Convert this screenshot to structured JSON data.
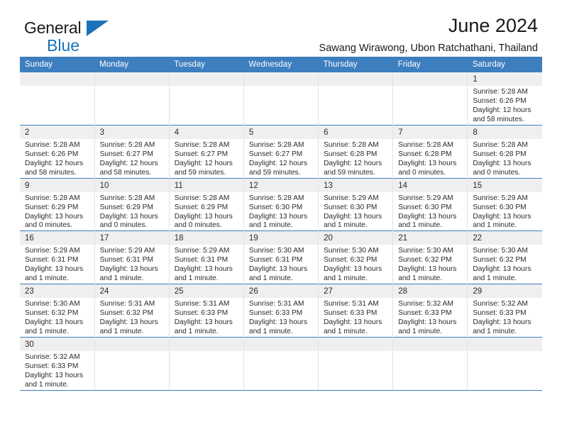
{
  "brand": {
    "name_part1": "General",
    "name_part2": "Blue",
    "triangle_color": "#1b72b8"
  },
  "header": {
    "month_title": "June 2024",
    "location": "Sawang Wirawong, Ubon Ratchathani, Thailand"
  },
  "theme": {
    "header_row_bg": "#3d7ebf",
    "daynum_bg": "#efefef",
    "grid_line": "#3d7ebf",
    "text": "#2b2b2b"
  },
  "weekday_headers": [
    "Sunday",
    "Monday",
    "Tuesday",
    "Wednesday",
    "Thursday",
    "Friday",
    "Saturday"
  ],
  "labels": {
    "sunrise": "Sunrise:",
    "sunset": "Sunset:",
    "daylight": "Daylight:"
  },
  "weeks": [
    [
      {
        "day": "",
        "blank": true
      },
      {
        "day": "",
        "blank": true
      },
      {
        "day": "",
        "blank": true
      },
      {
        "day": "",
        "blank": true
      },
      {
        "day": "",
        "blank": true
      },
      {
        "day": "",
        "blank": true
      },
      {
        "day": "1",
        "sunrise": "Sunrise: 5:28 AM",
        "sunset": "Sunset: 6:26 PM",
        "daylight_line1": "Daylight: 12 hours",
        "daylight_line2": "and 58 minutes."
      }
    ],
    [
      {
        "day": "2",
        "sunrise": "Sunrise: 5:28 AM",
        "sunset": "Sunset: 6:26 PM",
        "daylight_line1": "Daylight: 12 hours",
        "daylight_line2": "and 58 minutes."
      },
      {
        "day": "3",
        "sunrise": "Sunrise: 5:28 AM",
        "sunset": "Sunset: 6:27 PM",
        "daylight_line1": "Daylight: 12 hours",
        "daylight_line2": "and 58 minutes."
      },
      {
        "day": "4",
        "sunrise": "Sunrise: 5:28 AM",
        "sunset": "Sunset: 6:27 PM",
        "daylight_line1": "Daylight: 12 hours",
        "daylight_line2": "and 59 minutes."
      },
      {
        "day": "5",
        "sunrise": "Sunrise: 5:28 AM",
        "sunset": "Sunset: 6:27 PM",
        "daylight_line1": "Daylight: 12 hours",
        "daylight_line2": "and 59 minutes."
      },
      {
        "day": "6",
        "sunrise": "Sunrise: 5:28 AM",
        "sunset": "Sunset: 6:28 PM",
        "daylight_line1": "Daylight: 12 hours",
        "daylight_line2": "and 59 minutes."
      },
      {
        "day": "7",
        "sunrise": "Sunrise: 5:28 AM",
        "sunset": "Sunset: 6:28 PM",
        "daylight_line1": "Daylight: 13 hours",
        "daylight_line2": "and 0 minutes."
      },
      {
        "day": "8",
        "sunrise": "Sunrise: 5:28 AM",
        "sunset": "Sunset: 6:28 PM",
        "daylight_line1": "Daylight: 13 hours",
        "daylight_line2": "and 0 minutes."
      }
    ],
    [
      {
        "day": "9",
        "sunrise": "Sunrise: 5:28 AM",
        "sunset": "Sunset: 6:29 PM",
        "daylight_line1": "Daylight: 13 hours",
        "daylight_line2": "and 0 minutes."
      },
      {
        "day": "10",
        "sunrise": "Sunrise: 5:28 AM",
        "sunset": "Sunset: 6:29 PM",
        "daylight_line1": "Daylight: 13 hours",
        "daylight_line2": "and 0 minutes."
      },
      {
        "day": "11",
        "sunrise": "Sunrise: 5:28 AM",
        "sunset": "Sunset: 6:29 PM",
        "daylight_line1": "Daylight: 13 hours",
        "daylight_line2": "and 0 minutes."
      },
      {
        "day": "12",
        "sunrise": "Sunrise: 5:28 AM",
        "sunset": "Sunset: 6:30 PM",
        "daylight_line1": "Daylight: 13 hours",
        "daylight_line2": "and 1 minute."
      },
      {
        "day": "13",
        "sunrise": "Sunrise: 5:29 AM",
        "sunset": "Sunset: 6:30 PM",
        "daylight_line1": "Daylight: 13 hours",
        "daylight_line2": "and 1 minute."
      },
      {
        "day": "14",
        "sunrise": "Sunrise: 5:29 AM",
        "sunset": "Sunset: 6:30 PM",
        "daylight_line1": "Daylight: 13 hours",
        "daylight_line2": "and 1 minute."
      },
      {
        "day": "15",
        "sunrise": "Sunrise: 5:29 AM",
        "sunset": "Sunset: 6:30 PM",
        "daylight_line1": "Daylight: 13 hours",
        "daylight_line2": "and 1 minute."
      }
    ],
    [
      {
        "day": "16",
        "sunrise": "Sunrise: 5:29 AM",
        "sunset": "Sunset: 6:31 PM",
        "daylight_line1": "Daylight: 13 hours",
        "daylight_line2": "and 1 minute."
      },
      {
        "day": "17",
        "sunrise": "Sunrise: 5:29 AM",
        "sunset": "Sunset: 6:31 PM",
        "daylight_line1": "Daylight: 13 hours",
        "daylight_line2": "and 1 minute."
      },
      {
        "day": "18",
        "sunrise": "Sunrise: 5:29 AM",
        "sunset": "Sunset: 6:31 PM",
        "daylight_line1": "Daylight: 13 hours",
        "daylight_line2": "and 1 minute."
      },
      {
        "day": "19",
        "sunrise": "Sunrise: 5:30 AM",
        "sunset": "Sunset: 6:31 PM",
        "daylight_line1": "Daylight: 13 hours",
        "daylight_line2": "and 1 minute."
      },
      {
        "day": "20",
        "sunrise": "Sunrise: 5:30 AM",
        "sunset": "Sunset: 6:32 PM",
        "daylight_line1": "Daylight: 13 hours",
        "daylight_line2": "and 1 minute."
      },
      {
        "day": "21",
        "sunrise": "Sunrise: 5:30 AM",
        "sunset": "Sunset: 6:32 PM",
        "daylight_line1": "Daylight: 13 hours",
        "daylight_line2": "and 1 minute."
      },
      {
        "day": "22",
        "sunrise": "Sunrise: 5:30 AM",
        "sunset": "Sunset: 6:32 PM",
        "daylight_line1": "Daylight: 13 hours",
        "daylight_line2": "and 1 minute."
      }
    ],
    [
      {
        "day": "23",
        "sunrise": "Sunrise: 5:30 AM",
        "sunset": "Sunset: 6:32 PM",
        "daylight_line1": "Daylight: 13 hours",
        "daylight_line2": "and 1 minute."
      },
      {
        "day": "24",
        "sunrise": "Sunrise: 5:31 AM",
        "sunset": "Sunset: 6:32 PM",
        "daylight_line1": "Daylight: 13 hours",
        "daylight_line2": "and 1 minute."
      },
      {
        "day": "25",
        "sunrise": "Sunrise: 5:31 AM",
        "sunset": "Sunset: 6:33 PM",
        "daylight_line1": "Daylight: 13 hours",
        "daylight_line2": "and 1 minute."
      },
      {
        "day": "26",
        "sunrise": "Sunrise: 5:31 AM",
        "sunset": "Sunset: 6:33 PM",
        "daylight_line1": "Daylight: 13 hours",
        "daylight_line2": "and 1 minute."
      },
      {
        "day": "27",
        "sunrise": "Sunrise: 5:31 AM",
        "sunset": "Sunset: 6:33 PM",
        "daylight_line1": "Daylight: 13 hours",
        "daylight_line2": "and 1 minute."
      },
      {
        "day": "28",
        "sunrise": "Sunrise: 5:32 AM",
        "sunset": "Sunset: 6:33 PM",
        "daylight_line1": "Daylight: 13 hours",
        "daylight_line2": "and 1 minute."
      },
      {
        "day": "29",
        "sunrise": "Sunrise: 5:32 AM",
        "sunset": "Sunset: 6:33 PM",
        "daylight_line1": "Daylight: 13 hours",
        "daylight_line2": "and 1 minute."
      }
    ],
    [
      {
        "day": "30",
        "sunrise": "Sunrise: 5:32 AM",
        "sunset": "Sunset: 6:33 PM",
        "daylight_line1": "Daylight: 13 hours",
        "daylight_line2": "and 1 minute."
      },
      {
        "day": "",
        "blank": true
      },
      {
        "day": "",
        "blank": true
      },
      {
        "day": "",
        "blank": true
      },
      {
        "day": "",
        "blank": true
      },
      {
        "day": "",
        "blank": true
      },
      {
        "day": "",
        "blank": true
      }
    ]
  ]
}
